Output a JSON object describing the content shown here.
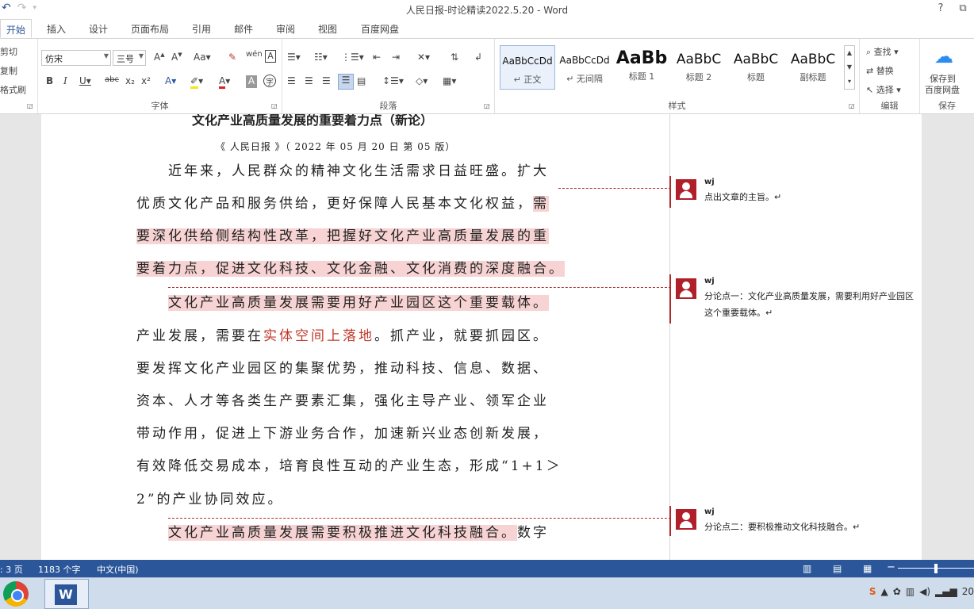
{
  "window": {
    "title": "人民日报-时论精读2022.5.20 - Word"
  },
  "titlebar": {
    "help": "?",
    "restore": "⧉"
  },
  "tabs": [
    "开始",
    "插入",
    "设计",
    "页面布局",
    "引用",
    "邮件",
    "审阅",
    "视图",
    "百度网盘"
  ],
  "ribbon": {
    "clipboard": {
      "cut": "剪切",
      "copy": "复制",
      "format_painter": "格式刷"
    },
    "font": {
      "name": "仿宋",
      "size": "三号",
      "group_label": "字体"
    },
    "paragraph": {
      "group_label": "段落"
    },
    "styles": {
      "group_label": "样式",
      "items": [
        {
          "sample": "AaBbCcDd",
          "name": "↵ 正文"
        },
        {
          "sample": "AaBbCcDd",
          "name": "↵ 无间隔"
        },
        {
          "sample": "AaBb",
          "name": "标题 1"
        },
        {
          "sample": "AaBbC",
          "name": "标题 2"
        },
        {
          "sample": "AaBbC",
          "name": "标题"
        },
        {
          "sample": "AaBbC",
          "name": "副标题"
        }
      ]
    },
    "editing": {
      "find": "查找",
      "replace": "替换",
      "select": "选择",
      "group_label": "编辑"
    },
    "save": {
      "label_line1": "保存到",
      "label_line2": "百度网盘",
      "group_label": "保存"
    }
  },
  "document": {
    "title": "文化产业高质量发展的重要着力点（新论）",
    "subtitle": "《 人民日报 》（ 2022 年 05 月 20 日  第 05 版）",
    "p1_l1": "近年来，人民群众的精神文化生活需求日益旺盛。扩大",
    "p1_l2a": "优质文化产品和服务供给，更好保障人民基本文化权益，",
    "p1_l2b": "需",
    "p1_l3": "要深化供给侧结构性改革，把握好文化产业高质量发展的重",
    "p1_l4": "要着力点，促进文化科技、文化金融、文化消费的深度融合。",
    "p2_l1": "文化产业高质量发展需要用好产业园区这个重要载体。",
    "p2_l2a": "产业发展，需要在",
    "p2_l2b": "实体空间上落地",
    "p2_l2c": "。抓产业，就要抓园区。",
    "p2_l3": "要发挥文化产业园区的集聚优势，推动科技、信息、数据、",
    "p2_l4": "资本、人才等各类生产要素汇集，强化主导产业、领军企业",
    "p2_l5": "带动作用，促进上下游业务合作，加速新兴业态创新发展，",
    "p2_l6": "有效降低交易成本，培育良性互动的产业生态，形成“1+1＞",
    "p2_l7": "2”的产业协同效应。",
    "p3_l1a": "文化产业高质量发展需要积极推进文化科技融合。",
    "p3_l1b": "数字"
  },
  "comments": [
    {
      "author": "wj",
      "text": "点出文章的主旨。↵"
    },
    {
      "author": "wj",
      "text": "分论点一：文化产业高质量发展，需要利用好产业园区这个重要载体。↵"
    },
    {
      "author": "wj",
      "text": "分论点二：要积极推动文化科技融合。↵"
    }
  ],
  "status": {
    "page": ": 3 页",
    "words": "1183 个字",
    "language": "中文(中国)"
  },
  "tray": {
    "clock": "20"
  },
  "colors": {
    "accent": "#2b579a",
    "highlight": "#f7d3d3",
    "comment_red": "#b02b2b"
  }
}
